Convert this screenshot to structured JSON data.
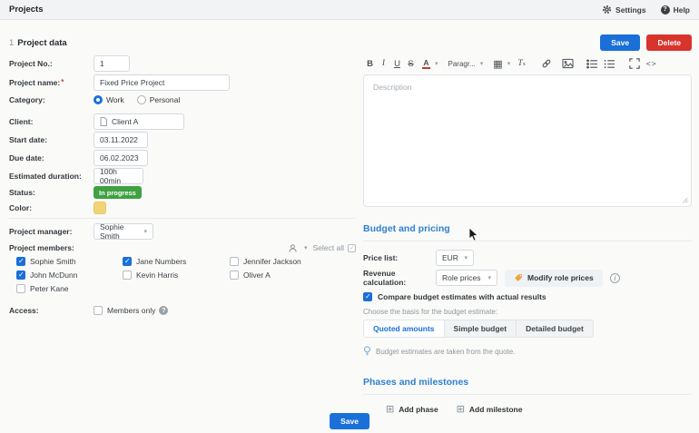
{
  "topbar": {
    "title": "Projects",
    "settings_label": "Settings",
    "help_label": "Help"
  },
  "section": {
    "number": "1",
    "title": "Project data",
    "save_label": "Save",
    "delete_label": "Delete"
  },
  "form": {
    "project_no": {
      "label": "Project No.:",
      "value": "1"
    },
    "project_name": {
      "label": "Project name:",
      "required_mark": "*",
      "value": "Fixed Price Project"
    },
    "category": {
      "label": "Category:",
      "options": [
        {
          "label": "Work",
          "selected": true
        },
        {
          "label": "Personal",
          "selected": false
        }
      ]
    },
    "client": {
      "label": "Client:",
      "value": "Client A"
    },
    "start_date": {
      "label": "Start date:",
      "value": "03.11.2022"
    },
    "due_date": {
      "label": "Due date:",
      "value": "06.02.2023"
    },
    "estimated_duration": {
      "label": "Estimated duration:",
      "value": "100h 00min"
    },
    "status": {
      "label": "Status:",
      "value": "In progress",
      "color": "#3fa142"
    },
    "color": {
      "label": "Color:",
      "value": "#f2d478"
    },
    "project_manager": {
      "label": "Project manager:",
      "value": "Sophie Smith"
    },
    "project_members": {
      "label": "Project members:",
      "select_all_label": "Select all",
      "select_all_checked": true
    },
    "members_columns": [
      [
        {
          "name": "Sophie Smith",
          "checked": true
        },
        {
          "name": "John McDunn",
          "checked": true
        },
        {
          "name": "Peter Kane",
          "checked": false
        }
      ],
      [
        {
          "name": "Jane Numbers",
          "checked": true
        },
        {
          "name": "Kevin Harris",
          "checked": false
        }
      ],
      [
        {
          "name": "Jennifer Jackson",
          "checked": false
        },
        {
          "name": "Oliver A",
          "checked": false
        }
      ]
    ],
    "access": {
      "label": "Access:",
      "option_label": "Members only",
      "checked": false
    }
  },
  "editor": {
    "placeholder": "Description",
    "toolbar": {
      "bold": "B",
      "italic": "I",
      "underline": "U",
      "strikethrough": "S",
      "color": "A",
      "paragraph": "Paragr...",
      "clear_t": "T",
      "clear_x": "x",
      "code": "<>"
    }
  },
  "budget": {
    "title": "Budget and pricing",
    "price_list": {
      "label": "Price list:",
      "value": "EUR"
    },
    "revenue_calculation": {
      "label": "Revenue calculation:",
      "value": "Role prices",
      "modify_button_label": "Modify role prices"
    },
    "compare_checkbox": {
      "label": "Compare budget estimates with actual results",
      "checked": true
    },
    "basis_caption": "Choose the basis for the budget estimate:",
    "basis_options": [
      {
        "label": "Quoted amounts",
        "active": true
      },
      {
        "label": "Simple budget",
        "active": false
      },
      {
        "label": "Detailed budget",
        "active": false
      }
    ],
    "hint": "Budget estimates are taken from the quote."
  },
  "phases": {
    "title": "Phases and milestones",
    "add_phase_label": "Add phase",
    "add_milestone_label": "Add milestone"
  },
  "footer": {
    "save_label": "Save"
  },
  "icons": {
    "caret_down": "▾",
    "table": "▦",
    "plus_square": "⊞",
    "help_mark": "?",
    "info_mark": "i",
    "question_mark": "?"
  },
  "colors": {
    "accent_blue": "#1a6fd9",
    "danger_red": "#d9342b",
    "success_green": "#3fa142",
    "swatch_yellow": "#f2d478",
    "heading_blue": "#2f80d0",
    "topbar_bg": "#f1f3f4",
    "page_bg": "#fafbf9"
  }
}
